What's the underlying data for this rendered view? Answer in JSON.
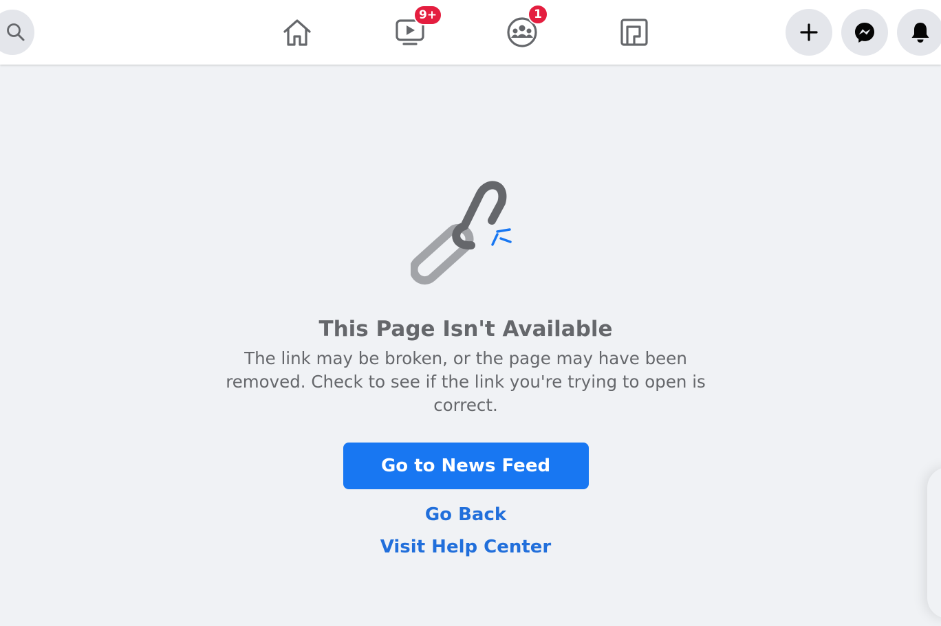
{
  "topbar": {
    "search": {
      "icon": "search-icon"
    },
    "nav": [
      {
        "name": "home",
        "icon": "home-icon",
        "badge": ""
      },
      {
        "name": "watch",
        "icon": "video-icon",
        "badge": "9+"
      },
      {
        "name": "groups",
        "icon": "groups-icon",
        "badge": "1"
      },
      {
        "name": "gaming",
        "icon": "gaming-icon",
        "badge": ""
      }
    ],
    "actions": [
      {
        "name": "create",
        "icon": "plus-icon"
      },
      {
        "name": "messenger",
        "icon": "messenger-icon"
      },
      {
        "name": "notifications",
        "icon": "bell-icon"
      }
    ]
  },
  "error": {
    "icon": "broken-link-icon",
    "title": "This Page Isn't Available",
    "description": "The link may be broken, or the page may have been removed. Check to see if the link you're trying to open is correct.",
    "primary_button": "Go to News Feed",
    "go_back": "Go Back",
    "help_center": "Visit Help Center"
  },
  "colors": {
    "background": "#f0f2f5",
    "topbar": "#ffffff",
    "accent": "#1877f2",
    "link": "#216fdb",
    "badge": "#e41e3f",
    "text_secondary": "#65676b"
  }
}
